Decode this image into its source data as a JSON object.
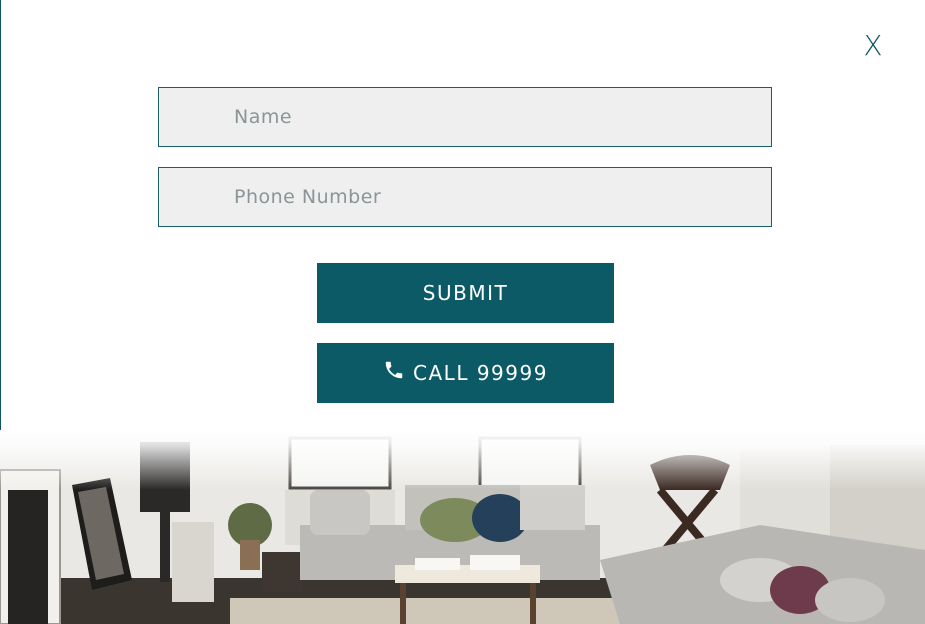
{
  "modal": {
    "close_label": "X"
  },
  "form": {
    "name_placeholder": "Name",
    "phone_placeholder": "Phone Number",
    "submit_label": "SUBMIT",
    "call_label": "CALL 99999"
  },
  "icons": {
    "phone": "phone-icon",
    "close": "close-icon"
  },
  "colors": {
    "accent": "#0d5a67",
    "field_background": "#efefef",
    "field_border": "#1d5c69"
  }
}
